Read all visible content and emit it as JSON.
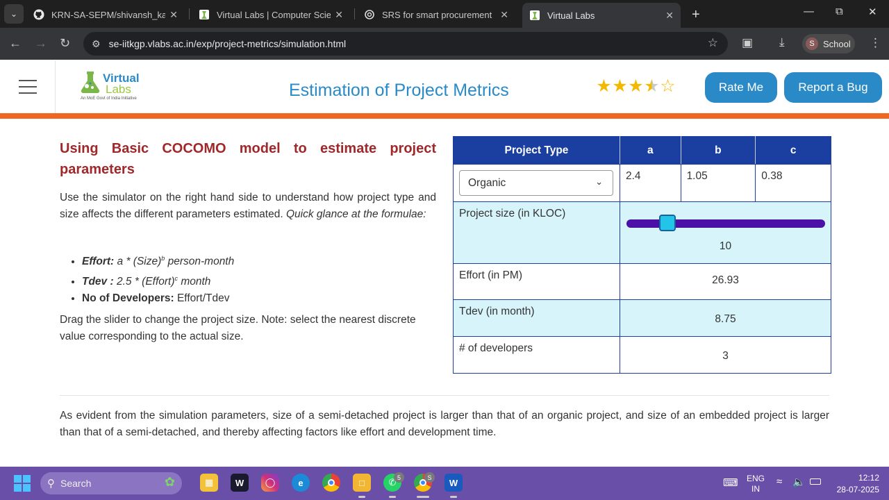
{
  "browser": {
    "tabs": [
      {
        "title": "KRN-SA-SEPM/shivansh_karan_",
        "icon": "github-icon"
      },
      {
        "title": "Virtual Labs | Computer Science",
        "icon": "vlabs-icon"
      },
      {
        "title": "SRS for smart procurement",
        "icon": "chatgpt-icon"
      },
      {
        "title": "Virtual Labs",
        "icon": "vlabs-icon"
      }
    ],
    "url": "se-iitkgp.vlabs.ac.in/exp/project-metrics/simulation.html",
    "profile_initial": "S",
    "profile_label": "School"
  },
  "header": {
    "logo_line1": "Virtual",
    "logo_line2": "Labs",
    "logo_tagline": "An MoE Govt of India Initiative",
    "title": "Estimation of Project Metrics",
    "rating_stars": 3.5,
    "rate_button": "Rate Me",
    "bug_button": "Report a Bug"
  },
  "main": {
    "heading": "Using Basic COCOMO model to estimate project parameters",
    "intro_plain": "Use the simulator on the right hand side to understand how project type and size affects the different parameters estimated. ",
    "intro_italic": "Quick glance at the formulae:",
    "formulas": {
      "effort_label": "Effort:",
      "effort_pre": "a * (Size)",
      "effort_sup": "b",
      "effort_post": " person-month",
      "tdev_label": "Tdev :",
      "tdev_pre": "2.5 * (Effort)",
      "tdev_sup": "c",
      "tdev_post": " month",
      "devs_label": "No of Developers:",
      "devs_value": "Effort/Tdev"
    },
    "drag_note": "Drag the slider to change the project size. Note: select the nearest discrete value corresponding to the actual size.",
    "footer_note": "As evident from the simulation parameters, size of a semi-detached project is larger than that of an organic project, and size of an embedded project is larger than that of a semi-detached, and thereby affecting factors like effort and development time."
  },
  "simulator": {
    "headers": {
      "type": "Project Type",
      "a": "a",
      "b": "b",
      "c": "c"
    },
    "project_type": "Organic",
    "a": "2.4",
    "b": "1.05",
    "c": "0.38",
    "size_label": "Project size (in KLOC)",
    "size_value": "10",
    "slider_fraction": 0.18,
    "effort_label": "Effort (in PM)",
    "effort_value": "26.93",
    "tdev_label": "Tdev (in month)",
    "tdev_value": "8.75",
    "devs_label": "# of developers",
    "devs_value": "3"
  },
  "taskbar": {
    "search_label": "Search",
    "lang_line1": "ENG",
    "lang_line2": "IN",
    "time": "12:12",
    "date": "28-07-2025",
    "whatsapp_badge": "5",
    "chrome_badge": "S"
  }
}
